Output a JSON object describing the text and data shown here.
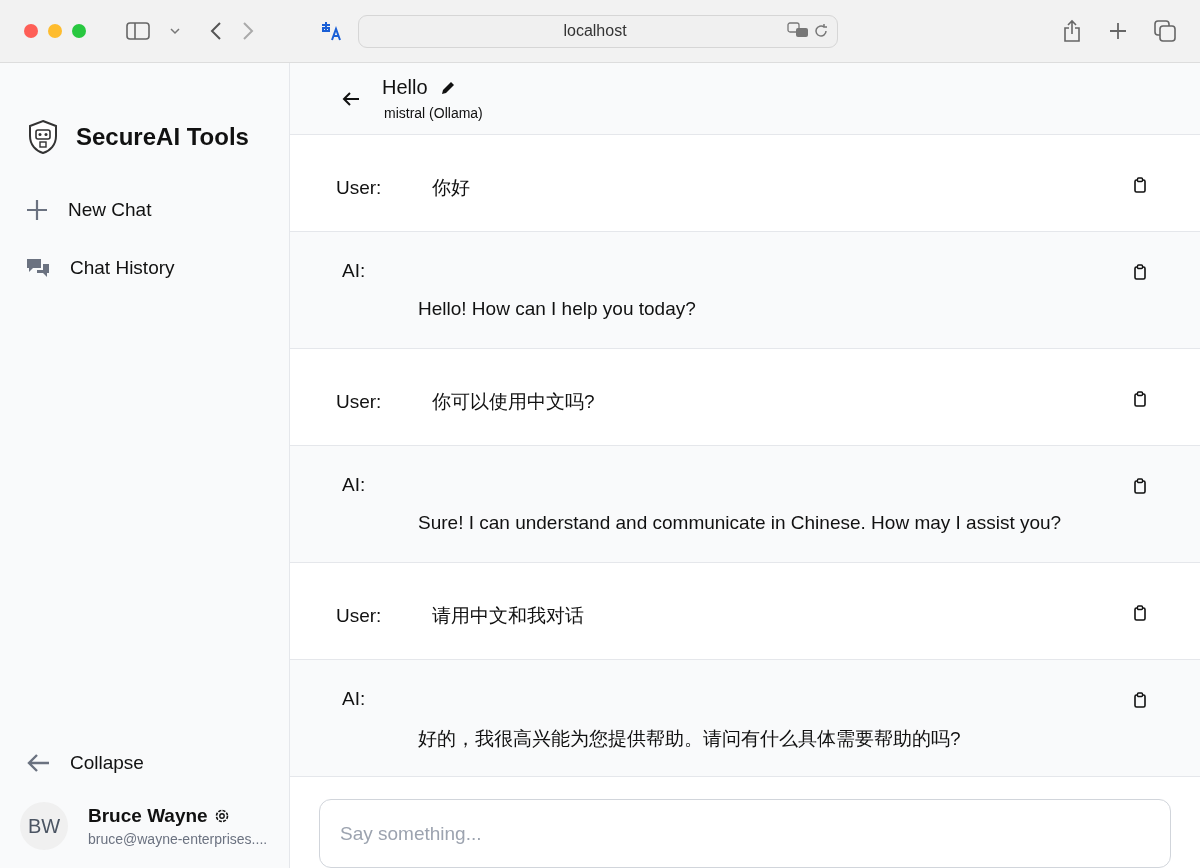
{
  "browser": {
    "address": "localhost"
  },
  "sidebar": {
    "brand": "SecureAI Tools",
    "items": [
      {
        "label": "New Chat",
        "kind": "new"
      },
      {
        "label": "Chat History",
        "kind": "history"
      }
    ],
    "collapse": "Collapse",
    "user": {
      "initials": "BW",
      "name": "Bruce Wayne",
      "email": "bruce@wayne-enterprises...."
    }
  },
  "chat": {
    "title": "Hello",
    "model": "mistral (Ollama)",
    "messages": [
      {
        "kind": "user",
        "speaker": "User:",
        "text": "你好"
      },
      {
        "kind": "ai",
        "speaker": "AI:",
        "text": "Hello! How can I help you today?"
      },
      {
        "kind": "user",
        "speaker": "User:",
        "text": "你可以使用中文吗?"
      },
      {
        "kind": "ai",
        "speaker": "AI:",
        "text": "Sure! I can understand and communicate in Chinese. How may I assist you?"
      },
      {
        "kind": "user",
        "speaker": "User:",
        "text": "请用中文和我对话"
      },
      {
        "kind": "ai",
        "speaker": "AI:",
        "text": "好的，我很高兴能为您提供帮助。请问有什么具体需要帮助的吗?"
      }
    ],
    "input": {
      "placeholder": "Say something..."
    }
  }
}
